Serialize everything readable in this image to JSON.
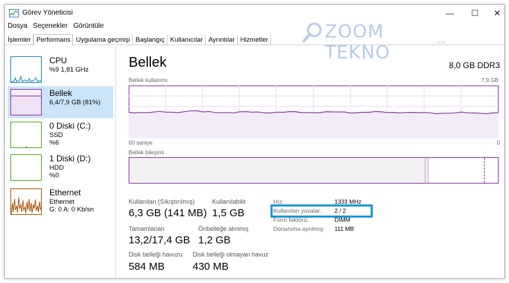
{
  "window": {
    "title": "Görev Yöneticisi",
    "minimize_glyph": "—",
    "maximize_glyph": "☐",
    "close_glyph": "✕"
  },
  "menu": [
    "Dosya",
    "Seçenekler",
    "Görüntüle"
  ],
  "tabs": [
    "İşlemler",
    "Performans",
    "Uygulama geçmişi",
    "Başlangıç",
    "Kullanıcılar",
    "Ayrıntılar",
    "Hizmetler"
  ],
  "active_tab": "Performans",
  "watermark": {
    "text": "ZOOM TEKNO",
    "sub": ".COM"
  },
  "sidebar": [
    {
      "name": "CPU",
      "line1": "%9  1,81 GHz",
      "line2": "",
      "line3": "",
      "color": "#1183c1",
      "active": false
    },
    {
      "name": "Bellek",
      "line1": "6,4/7,9 GB (81%)",
      "line2": "",
      "line3": "",
      "color": "#8b2fa5",
      "active": true
    },
    {
      "name": "0 Diski (C:)",
      "line1": "SSD",
      "line2": "%6",
      "line3": "",
      "color": "#4da60c",
      "active": false
    },
    {
      "name": "1 Diski (D:)",
      "line1": "HDD",
      "line2": "%0",
      "line3": "",
      "color": "#4da60c",
      "active": false
    },
    {
      "name": "Ethernet",
      "line1": "Ethernet",
      "line2": "G: 0  A: 0 Kb/sn",
      "line3": "",
      "color": "#a74f01",
      "active": false
    }
  ],
  "main": {
    "title": "Bellek",
    "spec": "8,0 GB DDR3",
    "usage_label": "Bellek kullanımı",
    "usage_max": "7,9 GB",
    "time_left": "60 saniye",
    "time_right": "0",
    "composition_label": "Bellek bileşimi",
    "usage_level": 0.81,
    "stats": {
      "in_use_label": "Kullanılan (Sıkıştırılmış)",
      "in_use_value": "6,3 GB (141 MB)",
      "available_label": "Kullanılabilir",
      "available_value": "1,5 GB",
      "committed_label": "Tamamlanan",
      "committed_value": "13,2/17,4 GB",
      "cached_label": "Önbelleğe alınmış",
      "cached_value": "1,2 GB",
      "paged_label": "Disk belleği havuzu",
      "paged_value": "584 MB",
      "nonpaged_label": "Disk belleği olmayan havuz",
      "nonpaged_value": "430 MB"
    },
    "details": {
      "speed_label": "Hız:",
      "speed_value": "1333 MHz",
      "slots_label": "Kullanılan yuvalar:",
      "slots_value": "2 / 2",
      "form_label": "Form faktörü:",
      "form_value": "DIMM",
      "reserved_label": "Donanıma ayrılmış:",
      "reserved_value": "111 MB"
    }
  },
  "colors": {
    "memory": "#8b2fa5",
    "cpu": "#1183c1",
    "disk": "#4da60c",
    "ethernet": "#a74f01",
    "selection": "#cce4f7",
    "highlight": "#1197d6"
  }
}
